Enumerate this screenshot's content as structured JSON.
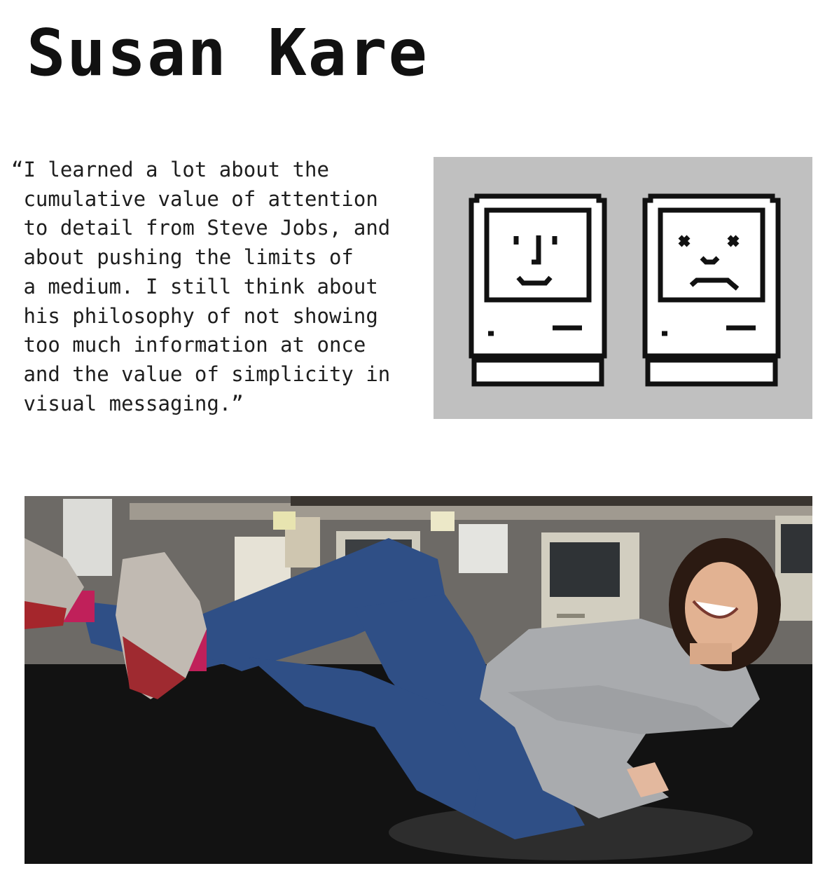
{
  "title": "Susan Kare",
  "quote": {
    "lines": [
      "“I learned a lot about the",
      " cumulative value of attention",
      " to detail from Steve Jobs, and",
      " about pushing the limits of",
      " a medium. I still think about",
      " his philosophy of not showing",
      " too much information at once",
      " and the value of simplicity in",
      " visual messaging.”"
    ]
  },
  "icons": [
    {
      "name": "happy-mac-icon"
    },
    {
      "name": "sad-mac-icon"
    }
  ],
  "colors": {
    "panel_background": "#c0c0c0",
    "icon_stroke": "#111111",
    "denim": "#2f4f86",
    "sweatshirt": "#a9abae",
    "sock": "#c0205a"
  },
  "photo": {
    "subject": "photo-susan-kare-at-desk"
  }
}
